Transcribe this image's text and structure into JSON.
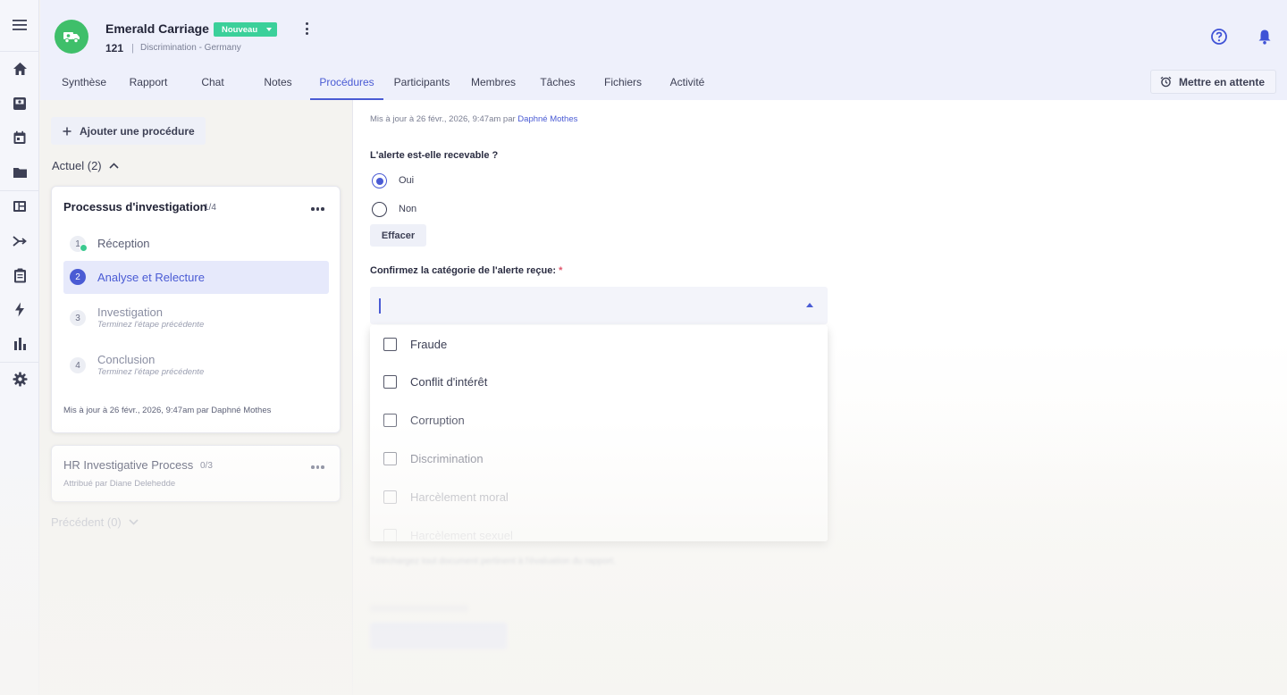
{
  "case": {
    "name": "Emerald Carriage",
    "status": "Nouveau",
    "number": "121",
    "separator": "|",
    "subtitle": "Discrimination - Germany"
  },
  "tabs": [
    {
      "label": "Synthèse",
      "active": false
    },
    {
      "label": "Rapport",
      "active": false
    },
    {
      "label": "Chat",
      "active": false
    },
    {
      "label": "Notes",
      "active": false
    },
    {
      "label": "Procédures",
      "active": true
    },
    {
      "label": "Participants",
      "active": false
    },
    {
      "label": "Membres",
      "active": false
    },
    {
      "label": "Tâches",
      "active": false
    },
    {
      "label": "Fichiers",
      "active": false
    },
    {
      "label": "Activité",
      "active": false
    }
  ],
  "hold_button": {
    "label": "Mettre en attente",
    "icon": "alarm-clock-icon"
  },
  "rail_icons": [
    "menu-icon",
    "home-icon",
    "inbox-icon",
    "calendar-icon",
    "folder-icon",
    "table-icon",
    "merge-icon",
    "clipboard-icon",
    "lightning-icon",
    "bar-chart-icon",
    "gear-icon"
  ],
  "procedures": {
    "add_label": "Ajouter une procédure",
    "current_section": "Actuel (2)",
    "previous_section": "Précédent (0)",
    "card1": {
      "title": "Processus d'investigation",
      "count": "1/4",
      "steps": [
        {
          "num": "1",
          "label": "Réception",
          "sub": "",
          "state": "done"
        },
        {
          "num": "2",
          "label": "Analyse et Relecture",
          "sub": "",
          "state": "active"
        },
        {
          "num": "3",
          "label": "Investigation",
          "sub": "Terminez l'étape précédente",
          "state": "locked"
        },
        {
          "num": "4",
          "label": "Conclusion",
          "sub": "Terminez l'étape précédente",
          "state": "locked"
        }
      ],
      "footer": "Mis à jour à 26 févr., 2026, 9:47am par Daphné Mothes"
    },
    "card2": {
      "title": "HR Investigative Process",
      "count": "0/3",
      "sub": "Attribué par Diane Delehedde"
    }
  },
  "form": {
    "updated_prefix": "Mis à jour à 26 févr., 2026, 9:47am par",
    "updated_author": "Daphné Mothes",
    "question1": "L'alerte est-elle recevable ?",
    "options1": [
      {
        "label": "Oui",
        "checked": true
      },
      {
        "label": "Non",
        "checked": false
      }
    ],
    "clear_label": "Effacer",
    "question2": "Confirmez la catégorie de l'alerte reçue:",
    "required_mark": "*",
    "categories": [
      "Fraude",
      "Conflit d'intérêt",
      "Corruption",
      "Discrimination",
      "Harcèlement moral",
      "Harcèlement sexuel"
    ],
    "hint": "Téléchargez tout document pertinent à l'évaluation du rapport."
  },
  "colors": {
    "accent": "#4a5bd4",
    "status_green": "#3bd09a",
    "avatar_green": "#3fbf6a",
    "required_red": "#e0556c"
  }
}
